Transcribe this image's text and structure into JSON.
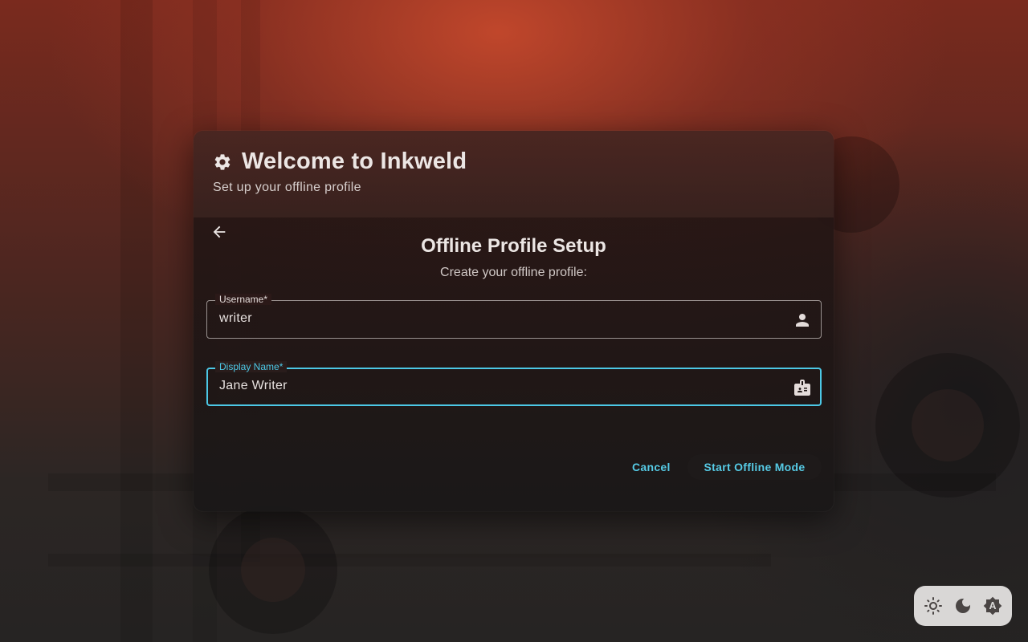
{
  "dialog": {
    "title": "Welcome to Inkweld",
    "subtitle": "Set up your offline profile",
    "section_title": "Offline Profile Setup",
    "section_subtitle": "Create your offline profile:",
    "fields": {
      "username": {
        "label": "Username*",
        "value": "writer",
        "icon": "person-icon"
      },
      "display_name": {
        "label": "Display Name*",
        "value": "Jane Writer",
        "icon": "badge-icon"
      }
    },
    "buttons": {
      "cancel": "Cancel",
      "start": "Start Offline Mode"
    }
  },
  "theme_switcher": {
    "options": [
      "light-mode-icon",
      "dark-mode-icon",
      "auto-mode-icon"
    ]
  },
  "colors": {
    "accent": "#4cc8e6",
    "dialog_bg": "#2a1d1c",
    "theme_switch_bg": "#d9d7d6"
  }
}
